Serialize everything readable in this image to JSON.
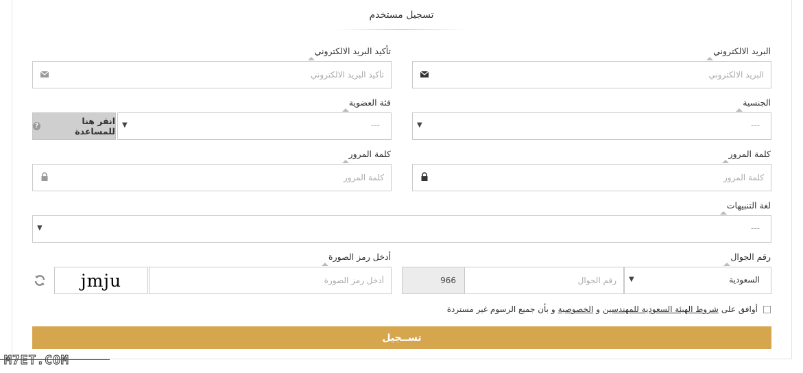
{
  "page": {
    "title": "تسجيل مستخدم"
  },
  "form": {
    "email": {
      "label": "البريد الالكتروني",
      "placeholder": "البريد الالكتروني"
    },
    "email_confirm": {
      "label": "تأكيد البريد الالكتروني",
      "placeholder": "تأكيد البريد الالكتروني"
    },
    "nationality": {
      "label": "الجنسية",
      "value": "---"
    },
    "membership": {
      "label": "فئة العضوية",
      "value": "---"
    },
    "help_button": {
      "label": "انقر هنا للمساعدة",
      "icon": "question-circle-icon"
    },
    "password": {
      "label": "كلمة المرور",
      "placeholder": "كلمة المرور"
    },
    "password_confirm": {
      "label": "كلمة المرور",
      "placeholder": "كلمة المرور"
    },
    "notify_language": {
      "label": "لغة التنبيهات",
      "value": "---"
    },
    "mobile": {
      "label": "رقم الجوال",
      "country": "السعودية",
      "placeholder": "رقم الجوال",
      "prefix": "966"
    },
    "captcha": {
      "label": "أدخل رمز الصورة",
      "placeholder": "أدخل رمز الصورة",
      "image_text": "jmju"
    },
    "agreement": {
      "text_start": "أوافق على",
      "terms_link": "شروط الهيئة السعودية للمهندسين",
      "and": "و",
      "privacy_link": "الخصوصية",
      "text_end": "و بأن جميع الرسوم غير مستردة"
    },
    "submit_label": "تســجيل"
  },
  "watermark": "M7ET.COM",
  "colors": {
    "accent": "#d6a64e",
    "border": "#c9c9c9",
    "help_bg": "#cfcfcf"
  }
}
